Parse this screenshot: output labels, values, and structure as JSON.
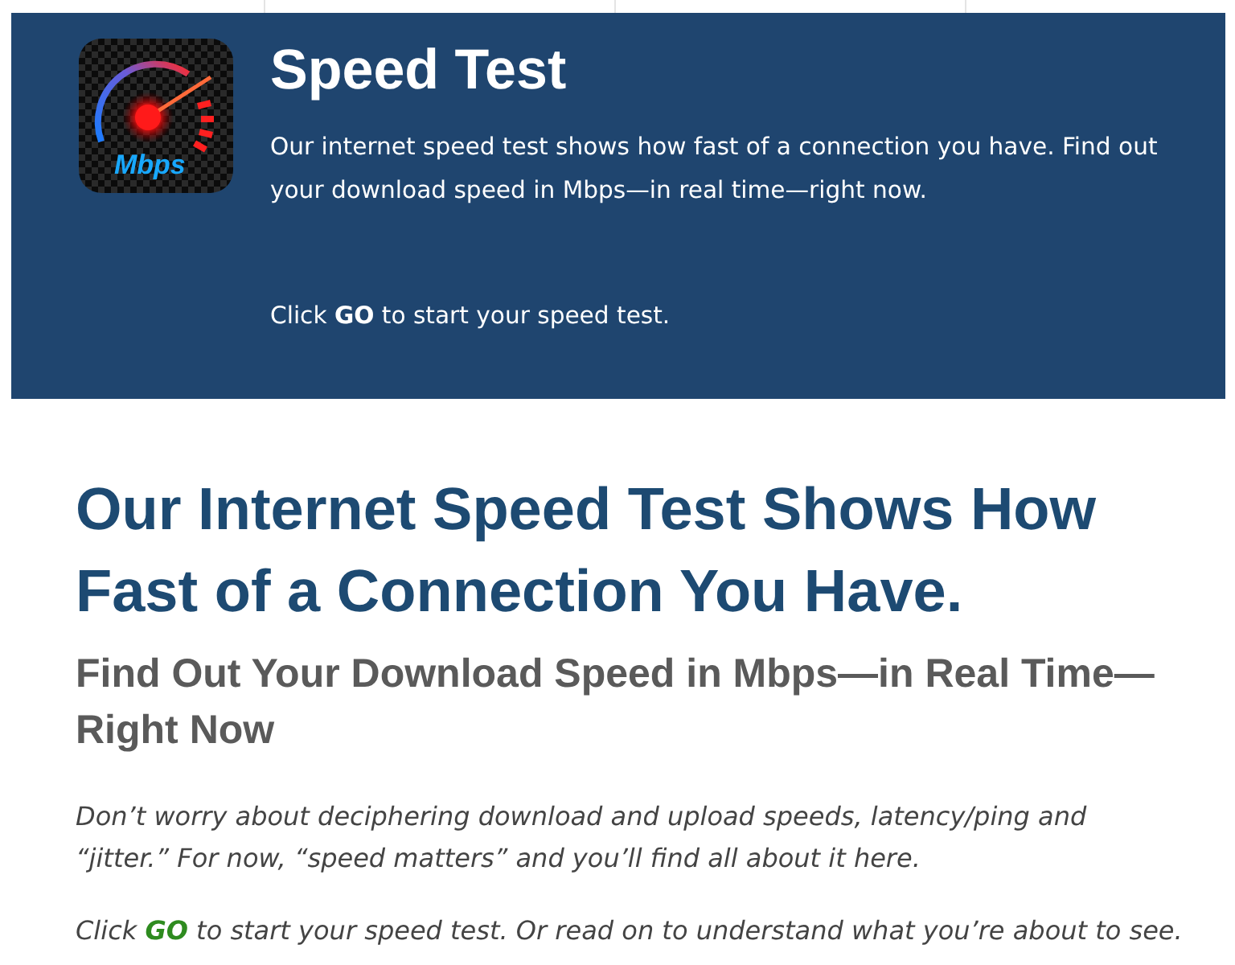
{
  "banner": {
    "logo_text": "Mbps",
    "title": "Speed Test",
    "description": "Our internet speed test shows how fast of a connection you have. Find out your download speed in Mbps—in real time—right now.",
    "instruction": "Click **GO** to start your speed test."
  },
  "article": {
    "heading": "Our Internet Speed Test Shows How Fast of a Connection You Have.",
    "subheading": "Find Out Your Download Speed in Mbps—in Real Time—Right Now",
    "paragraphs": [
      "Don’t worry about deciphering download and upload speeds, latency/ping and “jitter.” For now, “speed matters” and you’ll find all about it here.",
      "Click **GO** to start your speed test. Or read on to understand what you’re about to see."
    ]
  }
}
